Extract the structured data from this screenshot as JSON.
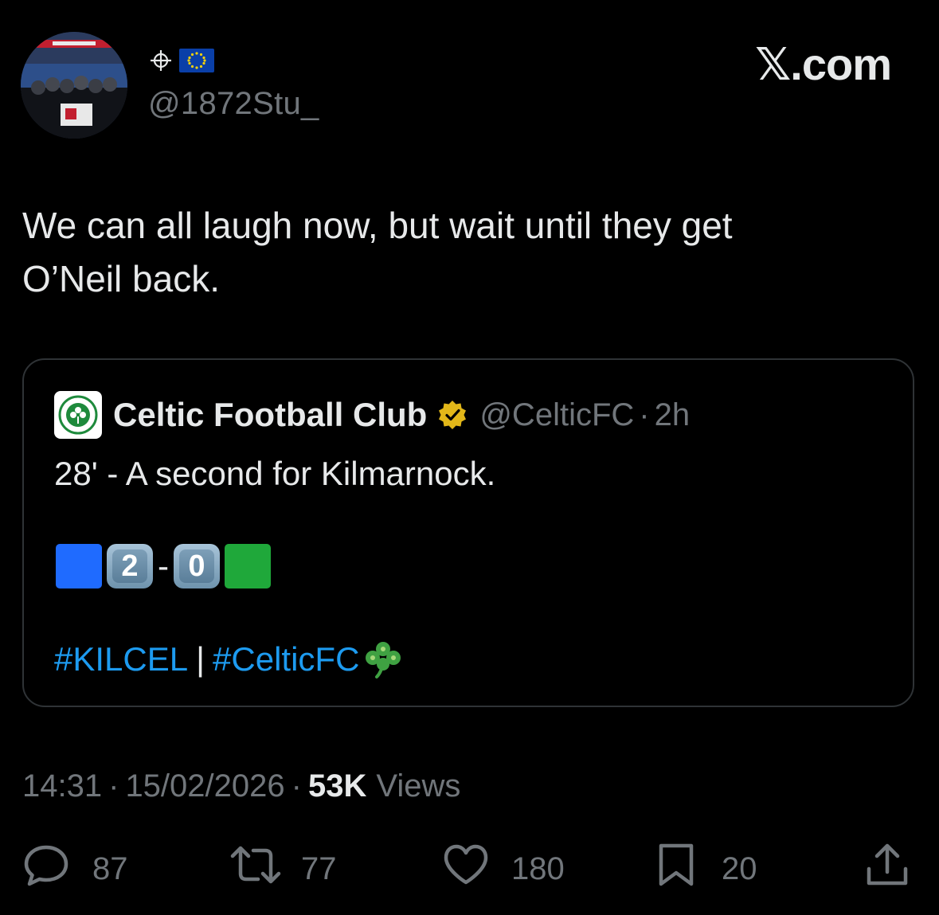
{
  "author": {
    "display_name_symbols": "⌖🇪🇺",
    "handle": "@1872Stu_"
  },
  "watermark": "𝕏.com",
  "tweet": {
    "line1": "We can all laugh now, but wait until they get",
    "line2": "O’Neil back."
  },
  "quoted_tweet": {
    "name": "Celtic Football Club",
    "handle": "@CelticFC",
    "separator": "·",
    "time": "2h",
    "body": "28' - A second for Kilmarnock.",
    "score": {
      "home_color": "#1f6bff",
      "home_goals": "2",
      "dash": "-",
      "away_goals": "0",
      "away_color": "#1fa83a"
    },
    "hashtag1": "#KILCEL",
    "pipe": "|",
    "hashtag2": "#CelticFC",
    "emoji": "shamrock"
  },
  "meta": {
    "time": "14:31",
    "dot1": "·",
    "date": "15/02/2026",
    "dot2": "·",
    "views_count": "53K",
    "views_label": "Views"
  },
  "actions": {
    "replies": "87",
    "reposts": "77",
    "likes": "180",
    "bookmarks": "20"
  },
  "colors": {
    "background": "#000000",
    "text": "#e7e9ea",
    "secondary": "#71767b",
    "link": "#1d9bf0",
    "border": "#2f3336",
    "verified_gold": "#e2b719"
  }
}
